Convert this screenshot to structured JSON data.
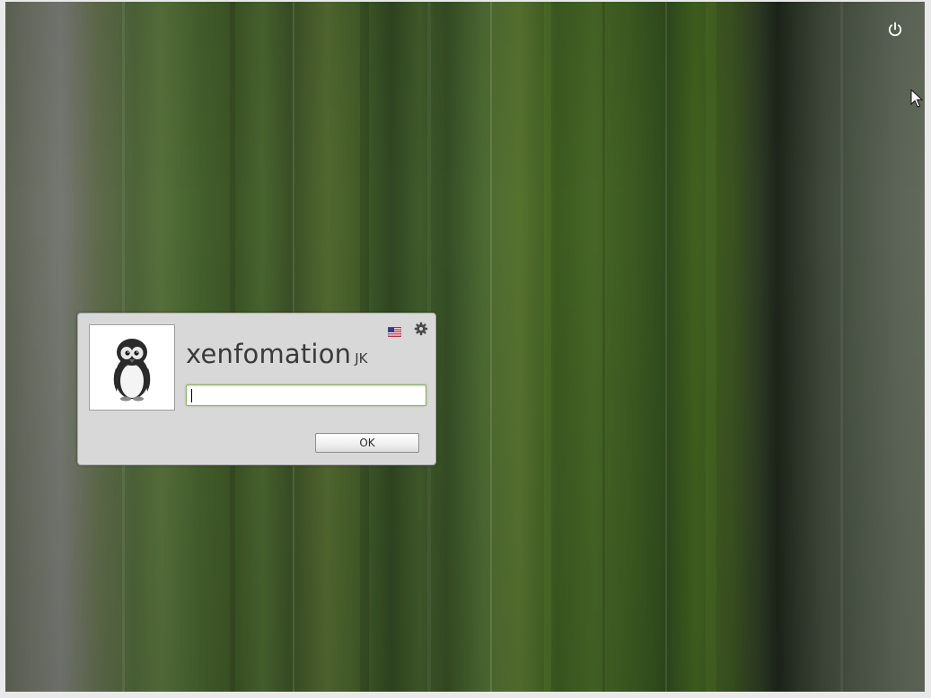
{
  "screen": {
    "background_colors": {
      "base_green": "#44602c",
      "dark_band": "#1d241b",
      "grey_left": "#757872"
    }
  },
  "top_right": {
    "power_icon": "power-icon"
  },
  "login_dialog": {
    "background_color": "#d8d8d8",
    "avatar_icon": "penguin-avatar-icon",
    "language_icon": "us-flag-icon",
    "settings_icon": "gear-icon",
    "username": "xenfomation",
    "user_tag": "JK",
    "password": {
      "value": "",
      "focus_color": "#8fb06c"
    },
    "ok_label": "OK"
  }
}
